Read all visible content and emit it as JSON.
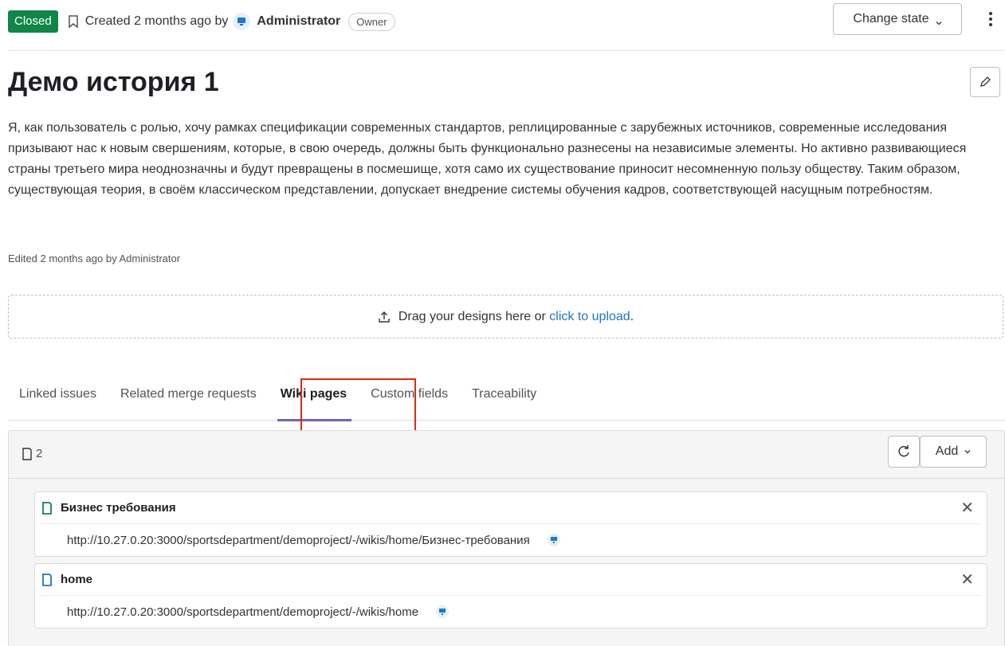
{
  "header": {
    "status_badge": "Closed",
    "created_text": "Created 2 months ago by",
    "author": "Administrator",
    "role": "Owner",
    "change_state_label": "Change state"
  },
  "issue": {
    "title": "Демо история 1",
    "description": "Я, как пользователь с ролью, хочу рамках спецификации современных стандартов, реплицированные с зарубежных источников, современные исследования призывают нас к новым свершениям, которые, в свою очередь, должны быть функционально разнесены на независимые элементы. Но активно развивающиеся страны третьего мира неоднозначны и будут превращены в посмешище, хотя само их существование приносит несомненную пользу обществу. Таким образом, существующая теория, в своём классическом представлении, допускает внедрение системы обучения кадров, соответствующей насущным потребностям.",
    "edited_text": "Edited 2 months ago by Administrator"
  },
  "dropzone": {
    "text": "Drag your designs here or",
    "link": "click to upload",
    "suffix": "."
  },
  "tabs": [
    {
      "label": "Linked issues",
      "active": false
    },
    {
      "label": "Related merge requests",
      "active": false
    },
    {
      "label": "Wiki pages",
      "active": true
    },
    {
      "label": "Custom fields",
      "active": false
    },
    {
      "label": "Traceability",
      "active": false
    }
  ],
  "wiki_panel": {
    "count": "2",
    "add_label": "Add",
    "items": [
      {
        "title": "Бизнес требования",
        "url": "http://10.27.0.20:3000/sportsdepartment/demoproject/-/wikis/home/Бизнес-требования",
        "icon_color": "#108548"
      },
      {
        "title": "home",
        "url": "http://10.27.0.20:3000/sportsdepartment/demoproject/-/wikis/home",
        "icon_color": "#1f75cb"
      }
    ]
  },
  "colors": {
    "closed_badge": "#108548",
    "link": "#1f75cb",
    "active_tab_underline": "#6b67b3",
    "highlight_box": "#dd2b0e"
  }
}
